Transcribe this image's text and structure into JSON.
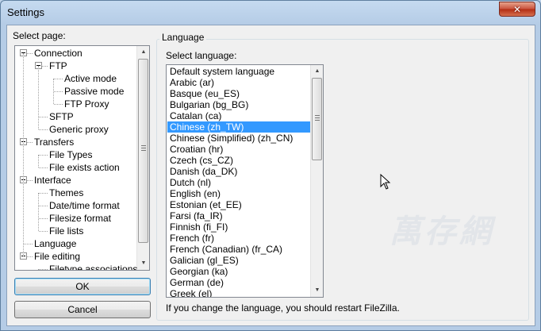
{
  "window": {
    "title": "Settings",
    "close_glyph": "✕"
  },
  "left": {
    "label": "Select page:",
    "tree": [
      {
        "label": "Connection",
        "level": 0,
        "expander": true
      },
      {
        "label": "FTP",
        "level": 1,
        "expander": true
      },
      {
        "label": "Active mode",
        "level": 2
      },
      {
        "label": "Passive mode",
        "level": 2
      },
      {
        "label": "FTP Proxy",
        "level": 2
      },
      {
        "label": "SFTP",
        "level": 1
      },
      {
        "label": "Generic proxy",
        "level": 1
      },
      {
        "label": "Transfers",
        "level": 0,
        "expander": true
      },
      {
        "label": "File Types",
        "level": 1
      },
      {
        "label": "File exists action",
        "level": 1
      },
      {
        "label": "Interface",
        "level": 0,
        "expander": true
      },
      {
        "label": "Themes",
        "level": 1
      },
      {
        "label": "Date/time format",
        "level": 1
      },
      {
        "label": "Filesize format",
        "level": 1
      },
      {
        "label": "File lists",
        "level": 1
      },
      {
        "label": "Language",
        "level": 0
      },
      {
        "label": "File editing",
        "level": 0,
        "expander": true
      },
      {
        "label": "Filetype associations",
        "level": 1
      }
    ],
    "ok_label": "OK",
    "cancel_label": "Cancel"
  },
  "right": {
    "group_title": "Language",
    "select_label": "Select language:",
    "languages": [
      "Default system language",
      "Arabic (ar)",
      "Basque (eu_ES)",
      "Bulgarian (bg_BG)",
      "Catalan (ca)",
      "Chinese (zh_TW)",
      "Chinese (Simplified) (zh_CN)",
      "Croatian (hr)",
      "Czech (cs_CZ)",
      "Danish (da_DK)",
      "Dutch (nl)",
      "English (en)",
      "Estonian (et_EE)",
      "Farsi (fa_IR)",
      "Finnish (fi_FI)",
      "French (fr)",
      "French (Canadian) (fr_CA)",
      "Galician (gl_ES)",
      "Georgian (ka)",
      "German (de)",
      "Greek (el)"
    ],
    "selected_language": "Chinese (zh_TW)",
    "note": "If you change the language, you should restart FileZilla."
  },
  "watermark": "萬存網",
  "colors": {
    "selection": "#3399ff",
    "dialog_bg": "#f0f0f0",
    "frame": "#b5cce6"
  }
}
